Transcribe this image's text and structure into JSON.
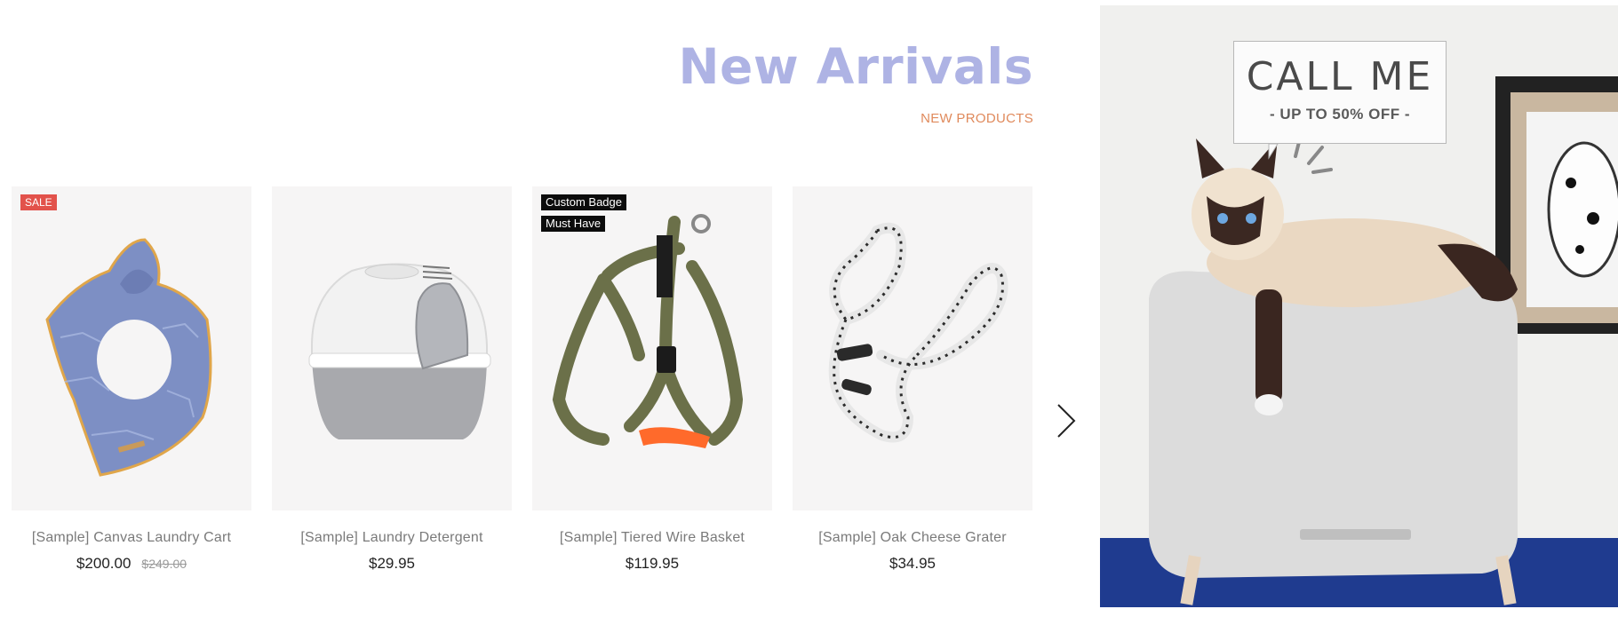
{
  "header": {
    "title": "New Arrivals",
    "subtitle": "NEW PRODUCTS"
  },
  "products": [
    {
      "name": "[Sample] Canvas Laundry Cart",
      "price": "$200.00",
      "old_price": "$249.00",
      "badges": [
        "SALE"
      ],
      "image_icon": "bandana-icon"
    },
    {
      "name": "[Sample] Laundry Detergent",
      "price": "$29.95",
      "old_price": "",
      "badges": [],
      "image_icon": "litter-box-icon"
    },
    {
      "name": "[Sample] Tiered Wire Basket",
      "price": "$119.95",
      "old_price": "",
      "badges": [
        "Custom Badge",
        "Must Have"
      ],
      "image_icon": "harness-icon"
    },
    {
      "name": "[Sample] Oak Cheese Grater",
      "price": "$34.95",
      "old_price": "",
      "badges": [],
      "image_icon": "rope-leash-icon"
    }
  ],
  "carousel": {
    "next_icon": "chevron-right-icon"
  },
  "banner": {
    "callout_title": "CALL ME",
    "callout_subtitle": "- UP TO 50% OFF -",
    "image": "cat-on-litter-box-photo"
  },
  "colors": {
    "title": "#aeb3e4",
    "subtitle": "#e08a5c",
    "sale_badge": "#e2524b",
    "dark_badge": "#0c0c0c",
    "card_bg": "#f6f5f5"
  }
}
